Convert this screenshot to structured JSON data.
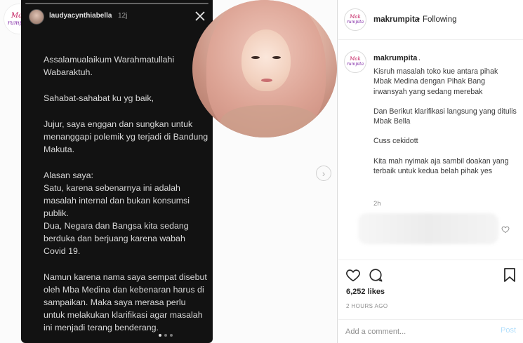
{
  "media": {
    "corner_logo": {
      "line1": "Mak",
      "line2": "rumpita"
    },
    "story": {
      "username": "laudyacynthiabella",
      "time": "12j",
      "paragraphs": [
        "Assalamualaikum Warahmatullahi Wabaraktuh.",
        "Sahabat-sahabat ku yg baik,",
        "Jujur, saya enggan dan sungkan untuk menanggapi polemik yg terjadi di Bandung Makuta.",
        "Alasan saya:",
        "Satu, karena sebenarnya ini adalah masalah internal dan bukan konsumsi publik.",
        "Dua, Negara dan Bangsa kita sedang berduka dan berjuang karena wabah Covid 19.",
        "Namun karena nama saya sempat disebut oleh Mba Medina dan kebenaran harus di sampaikan. Maka saya merasa perlu untuk melakukan klarifikasi agar masalah ini menjadi terang benderang."
      ],
      "progress_segments": 1,
      "page_dots": 3,
      "active_dot": 0
    }
  },
  "post": {
    "header": {
      "avatar": {
        "line1": "Mak",
        "line2": "rumpita"
      },
      "username": "makrumpita",
      "separator": "•",
      "follow_status": "Following"
    },
    "caption": {
      "username": "makrumpita",
      "username_suffix": ".",
      "paragraphs": [
        "Kisruh masalah toko kue antara pihak Mbak Medina dengan Pihak Bang irwansyah yang sedang merebak",
        "Dan Berikut klarifikasi langsung yang ditulis Mbak Bella",
        "Cuss cekidott",
        "Kita mah nyimak aja sambil doakan yang terbaik untuk kedua belah pihak yes"
      ],
      "time": "2h"
    },
    "likes": "6,252 likes",
    "age": "2 HOURS AGO",
    "comment_input": {
      "placeholder": "Add a comment..."
    },
    "post_button": "Post"
  },
  "icons": {
    "close": "close-icon",
    "next": "chevron-right-icon",
    "like": "heart-icon",
    "comment": "comment-bubble-icon",
    "save": "bookmark-icon"
  },
  "colors": {
    "story_bg": "#121212",
    "brand_pink": "#c2185b",
    "brand_purple": "#7b1fa2",
    "post_button": "#b2dffc"
  }
}
